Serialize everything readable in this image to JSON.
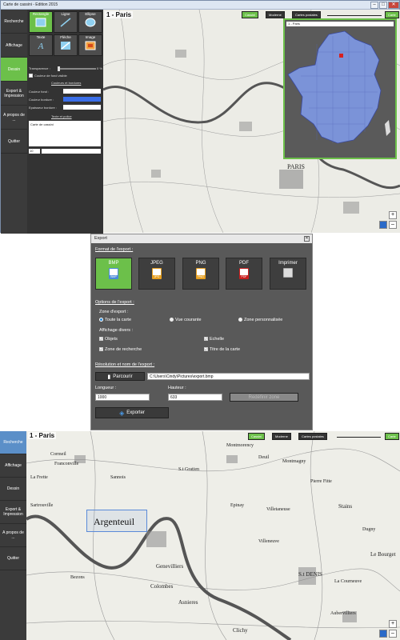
{
  "top_window": {
    "title": "Carte de cassini - Edition 2015",
    "nav": [
      "Recherche",
      "Affichage",
      "Dessin",
      "Export & Impression",
      "A propos de ...",
      "Quitter"
    ],
    "active_nav": "Dessin",
    "tools": [
      {
        "label": "Rectangle",
        "icon": "rectangle-icon"
      },
      {
        "label": "Ligne",
        "icon": "line-icon"
      },
      {
        "label": "Ellipse",
        "icon": "ellipse-icon"
      },
      {
        "label": "Texte",
        "icon": "text-icon"
      },
      {
        "label": "Flèche",
        "icon": "arrow-icon"
      },
      {
        "label": "Image",
        "icon": "image-icon"
      }
    ],
    "transparence_label": "Transparence :",
    "transparence_value": "0 %",
    "fond_visible_label": "Couleur de fond visible",
    "couleurs_link": "Couleurs et bordures",
    "couleur_fond_label": "Couleur fond :",
    "couleur_bordure_label": "Couleur bordure :",
    "epaisseur_label": "Epaisseur bordure :",
    "texte_police_link": "Texte et police",
    "texte_value": "Carte de cassini",
    "font_size_value": "10",
    "map_title": "1 - Paris",
    "map_tabs": [
      "Cassini",
      "Moderne",
      "Cartes postales"
    ],
    "active_map_tab": "Cassini",
    "carte_button": "Carte",
    "minimap_select": "1 - Paris",
    "map_city_label": "PARIS",
    "france_color": "#7b93d8"
  },
  "export_dialog": {
    "title": "Export",
    "format_section": "Format de l'export :",
    "formats": [
      "BMP",
      "JPEG",
      "PNG",
      "PDF",
      "Imprimer"
    ],
    "active_format": "BMP",
    "options_section": "Options de l'export :",
    "zone_label": "Zone d'export :",
    "zone_options": [
      "Toute la carte",
      "Vue courante",
      "Zone personnalisée"
    ],
    "zone_selected": "Toute la carte",
    "affichage_label": "Affichage divers :",
    "affichage_options": [
      "Objets",
      "Zone de recherche",
      "Echelle",
      "Titre de la carte"
    ],
    "resolution_section": "Résolution et nom de l'export :",
    "browse_button": "Parcourir",
    "path_value": "C:\\Users\\Cindy\\Pictures\\export.bmp",
    "longueur_label": "Longueur :",
    "longueur_value": "1000",
    "hauteur_label": "Hauteur :",
    "hauteur_value": "633",
    "redefine_button": "Redéfinir zone",
    "export_button": "Exporter"
  },
  "bottom_window": {
    "nav": [
      "Recherche",
      "Affichage",
      "Dessin",
      "Export & Impression",
      "A propos de ...",
      "Quitter"
    ],
    "active_nav": "Recherche",
    "map_title": "1 - Paris",
    "map_tabs": [
      "Cassini",
      "Moderne",
      "Cartes postales"
    ],
    "active_map_tab": "Cassini",
    "carte_button": "Carte",
    "selection_label": "Argenteuil",
    "places": [
      "Franconville",
      "Cormeil",
      "Sannois",
      "S.t Gratien",
      "Argenteuil",
      "Sartrouville",
      "Genevilliers",
      "Colombes",
      "Bezons",
      "Asnieres",
      "Clichy",
      "Epinay",
      "Villetaneuse",
      "Deuil",
      "Montmagny",
      "Pierre Fitte",
      "Stains",
      "S.t DENIS",
      "La Courneuve",
      "Aubervilliers",
      "La Frette",
      "Montmorency",
      "Villeneuve",
      "Le Bourget",
      "Dugny"
    ]
  }
}
